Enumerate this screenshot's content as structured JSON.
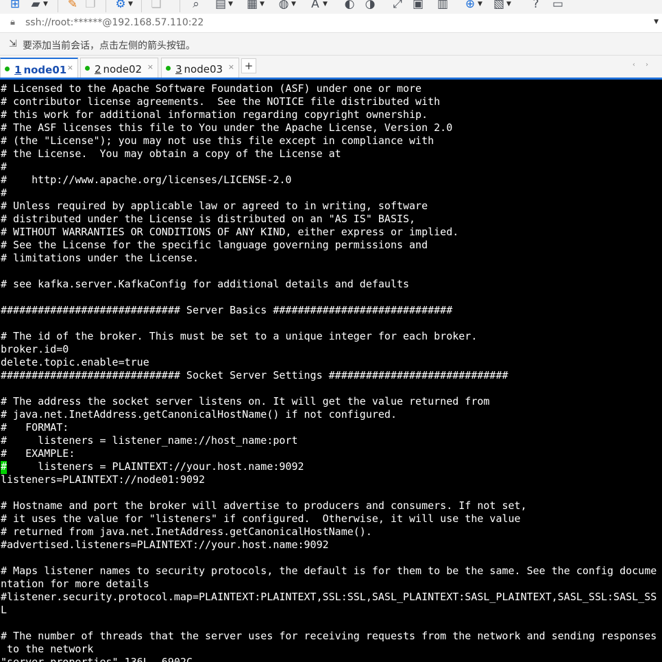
{
  "toolbar": {
    "icons": [
      {
        "name": "new-session-icon",
        "glyph": "⊞",
        "dropdown": false
      },
      {
        "name": "open-folder-icon",
        "glyph": "▰",
        "dropdown": true
      },
      {
        "name": "edit-pencil-icon",
        "glyph": "✎",
        "dropdown": false
      },
      {
        "name": "copy-icon",
        "glyph": "❐",
        "dropdown": false
      },
      {
        "name": "paste-icon",
        "glyph": "❏",
        "dropdown": false
      },
      {
        "name": "settings-icon",
        "glyph": "⚙",
        "dropdown": true
      },
      {
        "name": "find-icon",
        "glyph": "⌕",
        "dropdown": false
      },
      {
        "name": "printer-icon",
        "glyph": "▤",
        "dropdown": true
      },
      {
        "name": "layout-icon",
        "glyph": "▦",
        "dropdown": true
      },
      {
        "name": "globe-icon",
        "glyph": "◍",
        "dropdown": true
      },
      {
        "name": "font-icon",
        "glyph": "A",
        "dropdown": true
      },
      {
        "name": "xftp-icon",
        "glyph": "◐",
        "dropdown": false
      },
      {
        "name": "script-icon",
        "glyph": "◑",
        "dropdown": false
      },
      {
        "name": "fullscreen-icon",
        "glyph": "⤢",
        "dropdown": false
      },
      {
        "name": "lock-icon",
        "glyph": "▣",
        "dropdown": false
      },
      {
        "name": "keyboard-icon",
        "glyph": "▥",
        "dropdown": false
      },
      {
        "name": "add-session-icon",
        "glyph": "⊕",
        "dropdown": true
      },
      {
        "name": "window-icon",
        "glyph": "▧",
        "dropdown": true
      },
      {
        "name": "help-icon",
        "glyph": "?",
        "dropdown": false
      },
      {
        "name": "chat-icon",
        "glyph": "▭",
        "dropdown": false
      }
    ]
  },
  "address": {
    "value": "ssh://root:******@192.168.57.110:22",
    "lock_icon": "lock-icon",
    "dropdown_icon": "chevron-down-icon"
  },
  "hint": {
    "icon": "session-hint-icon",
    "text": "要添加当前会话，点击左侧的箭头按钮。"
  },
  "tabs": [
    {
      "number": "1",
      "label": "node01",
      "active": true,
      "status": "connected"
    },
    {
      "number": "2",
      "label": "node02",
      "active": false,
      "status": "connected"
    },
    {
      "number": "3",
      "label": "node03",
      "active": false,
      "status": "connected"
    }
  ],
  "tab_add_label": "+",
  "tab_close_label": "×",
  "tab_nav_label": "‹ ›",
  "colors": {
    "accent": "#1e6fd9",
    "status_connected": "#13b10c",
    "terminal_bg": "#000000",
    "terminal_fg": "#ffffff",
    "cursor": "#00d000"
  },
  "terminal": {
    "lines": [
      "# Licensed to the Apache Software Foundation (ASF) under one or more",
      "# contributor license agreements.  See the NOTICE file distributed with",
      "# this work for additional information regarding copyright ownership.",
      "# The ASF licenses this file to You under the Apache License, Version 2.0",
      "# (the \"License\"); you may not use this file except in compliance with",
      "# the License.  You may obtain a copy of the License at",
      "#",
      "#    http://www.apache.org/licenses/LICENSE-2.0",
      "#",
      "# Unless required by applicable law or agreed to in writing, software",
      "# distributed under the License is distributed on an \"AS IS\" BASIS,",
      "# WITHOUT WARRANTIES OR CONDITIONS OF ANY KIND, either express or implied.",
      "# See the License for the specific language governing permissions and",
      "# limitations under the License.",
      "",
      "# see kafka.server.KafkaConfig for additional details and defaults",
      "",
      "############################# Server Basics #############################",
      "",
      "# The id of the broker. This must be set to a unique integer for each broker.",
      "broker.id=0",
      "delete.topic.enable=true",
      "############################# Socket Server Settings #############################",
      "",
      "# The address the socket server listens on. It will get the value returned from",
      "# java.net.InetAddress.getCanonicalHostName() if not configured.",
      "#   FORMAT:",
      "#     listeners = listener_name://host_name:port",
      "#   EXAMPLE:",
      "#     listeners = PLAINTEXT://your.host.name:9092",
      "listeners=PLAINTEXT://node01:9092",
      "",
      "# Hostname and port the broker will advertise to producers and consumers. If not set,",
      "# it uses the value for \"listeners\" if configured.  Otherwise, it will use the value",
      "# returned from java.net.InetAddress.getCanonicalHostName().",
      "#advertised.listeners=PLAINTEXT://your.host.name:9092",
      "",
      "# Maps listener names to security protocols, the default is for them to be the same. See the config docume",
      "ntation for more details",
      "#listener.security.protocol.map=PLAINTEXT:PLAINTEXT,SSL:SSL,SASL_PLAINTEXT:SASL_PLAINTEXT,SASL_SSL:SASL_SS",
      "L",
      "",
      "# The number of threads that the server uses for receiving requests from the network and sending responses",
      " to the network",
      "\"server.properties\" 136L, 6902C"
    ]
  }
}
